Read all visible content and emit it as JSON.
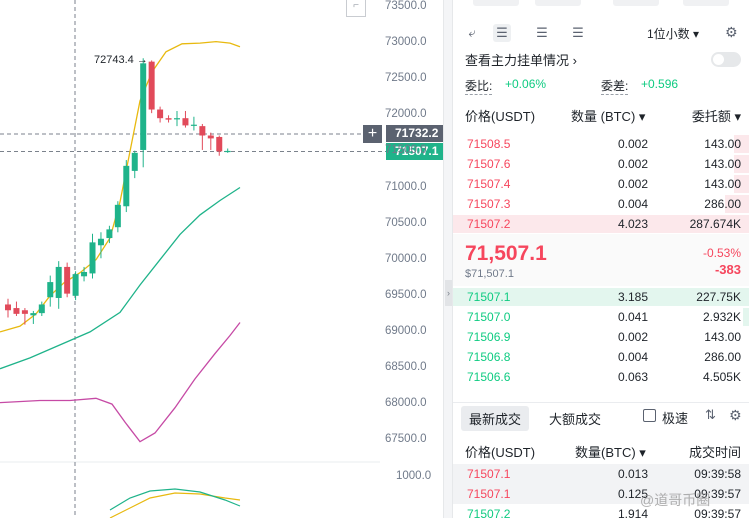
{
  "chart": {
    "price_ticks": [
      "73500.0",
      "73000.0",
      "72500.0",
      "72000.0",
      "71500.0",
      "71000.0",
      "70500.0",
      "70000.0",
      "69500.0",
      "69000.0",
      "68500.0",
      "68000.0",
      "67500.0"
    ],
    "indicator_tick": "1000.0",
    "crosshair_price": "71732.2",
    "last_price": "71507.1",
    "peak_label": "72743.4",
    "up_color": "#1fb38a",
    "down_color": "#e14a5a",
    "candles": [
      {
        "o": 69380,
        "h": 69460,
        "l": 69200,
        "c": 69300
      },
      {
        "o": 69330,
        "h": 69420,
        "l": 69220,
        "c": 69250
      },
      {
        "o": 69300,
        "h": 69330,
        "l": 69100,
        "c": 69250
      },
      {
        "o": 69230,
        "h": 69290,
        "l": 69110,
        "c": 69260
      },
      {
        "o": 69260,
        "h": 69420,
        "l": 69220,
        "c": 69380
      },
      {
        "o": 69480,
        "h": 69780,
        "l": 69350,
        "c": 69690
      },
      {
        "o": 69470,
        "h": 69980,
        "l": 69320,
        "c": 69900
      },
      {
        "o": 69900,
        "h": 69960,
        "l": 69480,
        "c": 69530
      },
      {
        "o": 69500,
        "h": 69840,
        "l": 69440,
        "c": 69800
      },
      {
        "o": 69770,
        "h": 69900,
        "l": 69700,
        "c": 69830
      },
      {
        "o": 69810,
        "h": 70360,
        "l": 69740,
        "c": 70240
      },
      {
        "o": 70200,
        "h": 70380,
        "l": 70020,
        "c": 70290
      },
      {
        "o": 70300,
        "h": 70470,
        "l": 70230,
        "c": 70420
      },
      {
        "o": 70450,
        "h": 70810,
        "l": 70380,
        "c": 70760
      },
      {
        "o": 70740,
        "h": 71380,
        "l": 70660,
        "c": 71300
      },
      {
        "o": 71230,
        "h": 71510,
        "l": 71130,
        "c": 71480
      },
      {
        "o": 71520,
        "h": 72790,
        "l": 71280,
        "c": 72720
      },
      {
        "o": 72743,
        "h": 72760,
        "l": 72030,
        "c": 72080
      },
      {
        "o": 72080,
        "h": 72120,
        "l": 71900,
        "c": 71960
      },
      {
        "o": 71960,
        "h": 72000,
        "l": 71900,
        "c": 71940
      },
      {
        "o": 71950,
        "h": 72060,
        "l": 71850,
        "c": 71960
      },
      {
        "o": 71960,
        "h": 72060,
        "l": 71830,
        "c": 71860
      },
      {
        "o": 71860,
        "h": 71980,
        "l": 71790,
        "c": 71870
      },
      {
        "o": 71850,
        "h": 71880,
        "l": 71520,
        "c": 71720
      },
      {
        "o": 71720,
        "h": 71760,
        "l": 71520,
        "c": 71680
      },
      {
        "o": 71700,
        "h": 71720,
        "l": 71440,
        "c": 71500
      },
      {
        "o": 71490,
        "h": 71540,
        "l": 71480,
        "c": 71507
      }
    ]
  },
  "book": {
    "decimal_select": "1位小数 ▾",
    "main_orders_label": "查看主力挂单情况 ›",
    "wb_label": "委比:",
    "wb_value": "+0.06%",
    "wc_label": "委差:",
    "wc_value": "+0.596",
    "header": {
      "price": "价格(USDT)",
      "amount": "数量 (BTC) ▾",
      "total": "委托额 ▾"
    },
    "asks": [
      {
        "price": "71508.5",
        "amount": "0.002",
        "total": "143.00",
        "depth": 0.05
      },
      {
        "price": "71507.6",
        "amount": "0.002",
        "total": "143.00",
        "depth": 0.05
      },
      {
        "price": "71507.4",
        "amount": "0.002",
        "total": "143.00",
        "depth": 0.05
      },
      {
        "price": "71507.3",
        "amount": "0.004",
        "total": "286.00",
        "depth": 0.08
      },
      {
        "price": "71507.2",
        "amount": "4.023",
        "total": "287.674K",
        "depth": 1.0
      }
    ],
    "mid_price": "71,507.1",
    "mid_sub": "$71,507.1",
    "mid_pct": "-0.53%",
    "mid_change": "-383",
    "bids": [
      {
        "price": "71507.1",
        "amount": "3.185",
        "total": "227.75K",
        "depth": 1.0
      },
      {
        "price": "71507.0",
        "amount": "0.041",
        "total": "2.932K",
        "depth": 0.02
      },
      {
        "price": "71506.9",
        "amount": "0.002",
        "total": "143.00",
        "depth": 0.0
      },
      {
        "price": "71506.8",
        "amount": "0.004",
        "total": "286.00",
        "depth": 0.0
      },
      {
        "price": "71506.6",
        "amount": "0.063",
        "total": "4.505K",
        "depth": 0.0
      }
    ]
  },
  "trades": {
    "tab_latest": "最新成交",
    "tab_large": "大额成交",
    "filter_label": "极速",
    "header": {
      "price": "价格(USDT)",
      "amount": "数量(BTC) ▾",
      "time": "成交时间"
    },
    "rows": [
      {
        "price": "71507.1",
        "amount": "0.013",
        "time": "09:39:58",
        "side": "sell"
      },
      {
        "price": "71507.1",
        "amount": "0.125",
        "time": "09:39:57",
        "side": "sell"
      },
      {
        "price": "71507.2",
        "amount": "1.914",
        "time": "09:39:57",
        "side": "buy"
      }
    ]
  },
  "watermark": "@道哥币圈"
}
